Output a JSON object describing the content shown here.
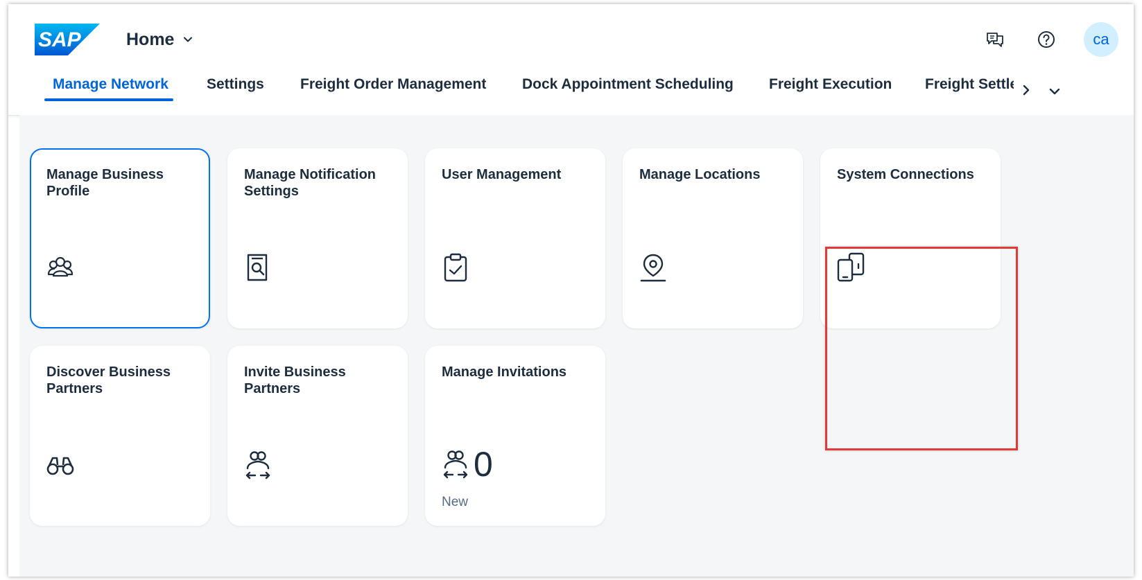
{
  "shell": {
    "logo_text": "SAP",
    "home_title": "Home",
    "avatar_initials": "ca"
  },
  "tabs": [
    {
      "label": "Manage Network",
      "active": true
    },
    {
      "label": "Settings",
      "active": false
    },
    {
      "label": "Freight Order Management",
      "active": false
    },
    {
      "label": "Dock Appointment Scheduling",
      "active": false
    },
    {
      "label": "Freight Execution",
      "active": false
    },
    {
      "label": "Freight Settlement",
      "active": false
    }
  ],
  "tiles": [
    {
      "title": "Manage Business Profile",
      "icon": "group-icon",
      "focused": true
    },
    {
      "title": "Manage Notification Settings",
      "icon": "document-search-icon"
    },
    {
      "title": "User Management",
      "icon": "clipboard-check-icon"
    },
    {
      "title": "Manage Locations",
      "icon": "location-pin-icon"
    },
    {
      "title": "System Connections",
      "icon": "devices-icon",
      "highlighted": true
    },
    {
      "title": "Discover Business Partners",
      "icon": "binoculars-icon"
    },
    {
      "title": "Invite Business Partners",
      "icon": "group-transfer-icon"
    },
    {
      "title": "Manage Invitations",
      "icon": "group-transfer-icon",
      "kpi_value": "0",
      "kpi_unit": "New"
    }
  ],
  "colors": {
    "brand_blue": "#0064d9",
    "focus_border": "#0070f2",
    "highlight_red": "#e03b3b",
    "avatar_bg": "#d1efff",
    "content_bg": "#f5f6f7"
  }
}
